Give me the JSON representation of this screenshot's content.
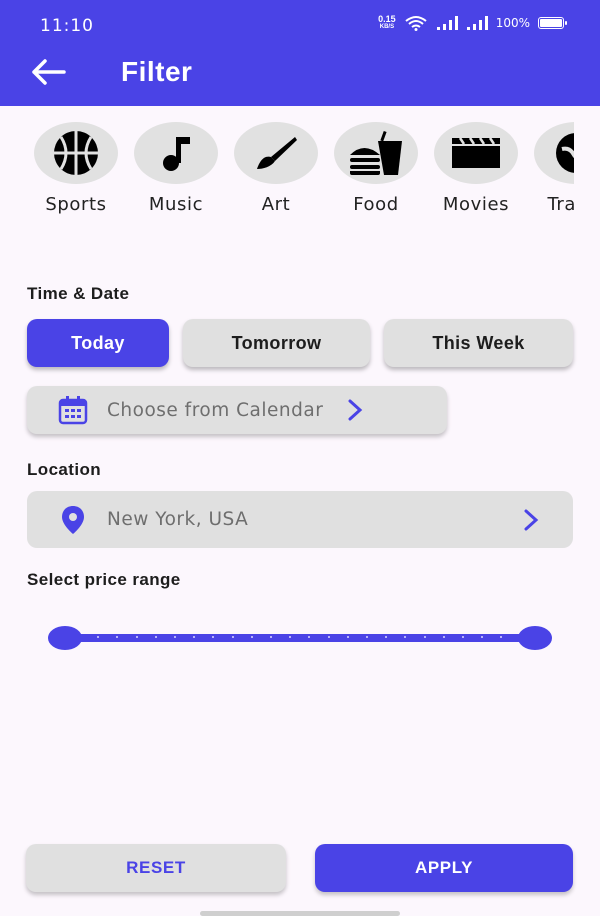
{
  "status_bar": {
    "time": "11:10",
    "net_speed_value": "0.15",
    "net_speed_unit": "KB/S",
    "battery": "100%"
  },
  "header": {
    "title": "Filter",
    "back_icon": "arrow-left-icon"
  },
  "categories": [
    {
      "label": "Sports",
      "icon": "basketball-icon"
    },
    {
      "label": "Music",
      "icon": "music-note-icon"
    },
    {
      "label": "Art",
      "icon": "paintbrush-icon"
    },
    {
      "label": "Food",
      "icon": "burger-drink-icon"
    },
    {
      "label": "Movies",
      "icon": "clapperboard-icon"
    },
    {
      "label": "Travel",
      "icon": "globe-icon"
    }
  ],
  "time_date": {
    "title": "Time & Date",
    "options": [
      {
        "label": "Today",
        "selected": true
      },
      {
        "label": "Tomorrow",
        "selected": false
      },
      {
        "label": "This Week",
        "selected": false
      }
    ],
    "calendar_placeholder": "Choose from Calendar"
  },
  "location": {
    "title": "Location",
    "value": "New York, USA"
  },
  "price": {
    "title": "Select price range",
    "range_min_fraction": 0.0,
    "range_max_fraction": 1.0
  },
  "actions": {
    "reset": "RESET",
    "apply": "APPLY"
  },
  "colors": {
    "primary": "#4a43e6",
    "surface": "#e0e0e0",
    "background": "#fcf7fd"
  }
}
